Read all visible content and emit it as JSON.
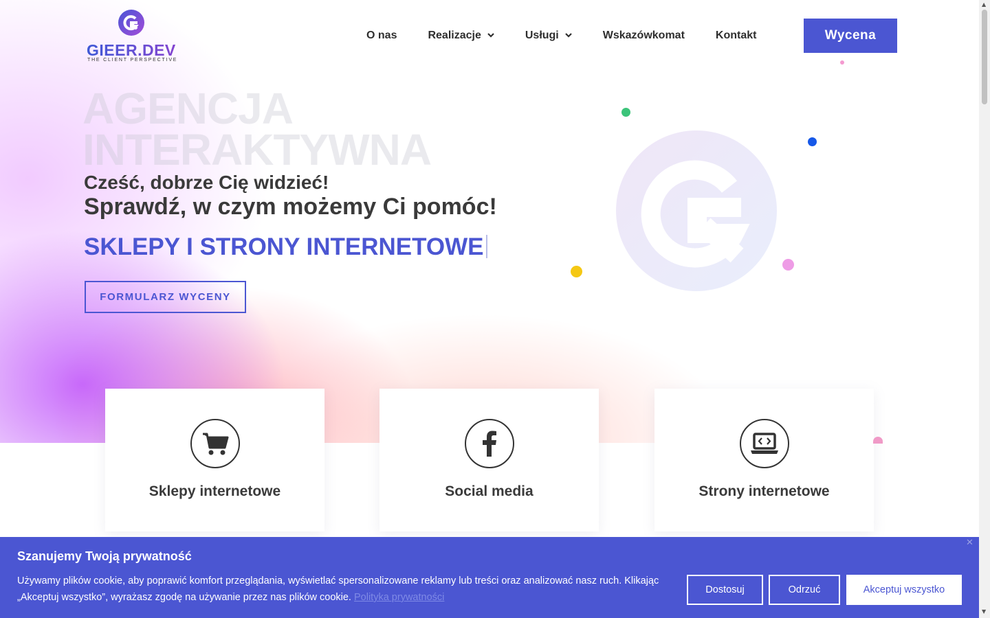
{
  "brand": {
    "name": "GIEER.DEV",
    "tagline": "THE CLIENT PERSPECTIVE",
    "accent": "#4b56d2"
  },
  "nav": {
    "items": [
      {
        "label": "O nas",
        "has_dropdown": false
      },
      {
        "label": "Realizacje",
        "has_dropdown": true
      },
      {
        "label": "Usługi",
        "has_dropdown": true
      },
      {
        "label": "Wskazówkomat",
        "has_dropdown": false
      },
      {
        "label": "Kontakt",
        "has_dropdown": false
      }
    ],
    "cta_label": "Wycena"
  },
  "hero": {
    "big_title_line1": "AGENCJA",
    "big_title_line2": "INTERAKTYWNA",
    "greeting": "Cześć, dobrze Cię widzieć!",
    "subheading": "Sprawdź, w czym możemy Ci pomóc!",
    "typed_text": "SKLEPY I STRONY INTERNETOWE",
    "form_button": "FORMULARZ WYCENY"
  },
  "cards": [
    {
      "label": "Sklepy internetowe",
      "icon": "shopping-cart-icon"
    },
    {
      "label": "Social media",
      "icon": "facebook-icon"
    },
    {
      "label": "Strony internetowe",
      "icon": "laptop-code-icon"
    }
  ],
  "cookie": {
    "title": "Szanujemy Twoją prywatność",
    "text": "Używamy plików cookie, aby poprawić komfort przeglądania, wyświetlać spersonalizowane reklamy lub treści oraz analizować nasz ruch. Klikając „Akceptuj wszystko”, wyrażasz zgodę na używanie przez nas plików cookie.",
    "policy_link": "Polityka prywatności",
    "customize": "Dostosuj",
    "reject": "Odrzuć",
    "accept": "Akceptuj wszystko",
    "close_symbol": "✕"
  }
}
